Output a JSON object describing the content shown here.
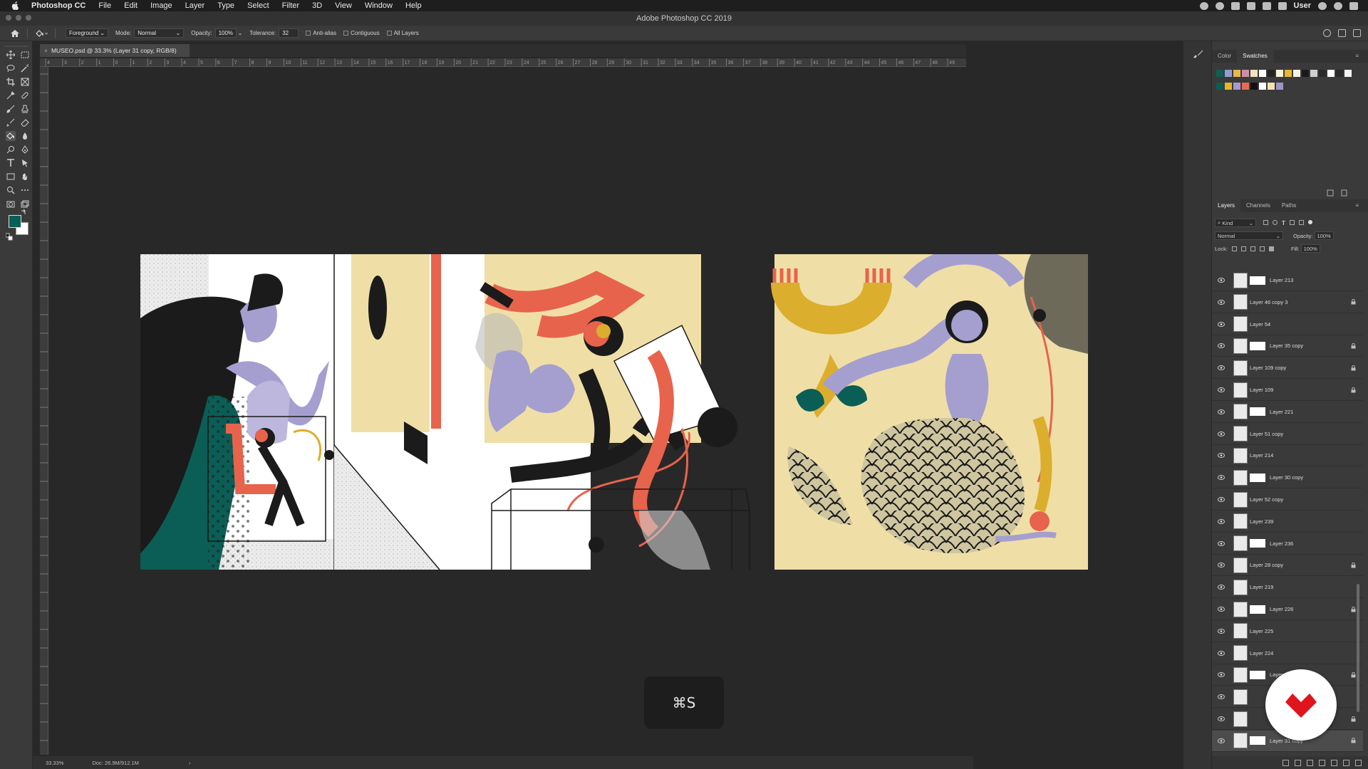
{
  "menubar": {
    "app": "Photoshop CC",
    "items": [
      "File",
      "Edit",
      "Image",
      "Layer",
      "Type",
      "Select",
      "Filter",
      "3D",
      "View",
      "Window",
      "Help"
    ],
    "user": "User"
  },
  "window": {
    "title": "Adobe Photoshop CC 2019"
  },
  "options": {
    "fill_source": "Foreground",
    "mode_label": "Mode:",
    "mode_value": "Normal",
    "opacity_label": "Opacity:",
    "opacity_value": "100%",
    "tolerance_label": "Tolerance:",
    "tolerance_value": "32",
    "anti_alias": "Anti-alias",
    "contiguous": "Contiguous",
    "all_layers": "All Layers"
  },
  "document": {
    "tab": "MUSEO.psd @ 33.3% (Layer 31 copy, RGB/8)",
    "zoom": "33.33%",
    "doc_size": "Doc: 26.9M/912.1M"
  },
  "ruler_top": [
    "4",
    "3",
    "2",
    "1",
    "0",
    "1",
    "2",
    "3",
    "4",
    "5",
    "6",
    "7",
    "8",
    "9",
    "10",
    "11",
    "12",
    "13",
    "14",
    "15",
    "16",
    "17",
    "18",
    "19",
    "20",
    "21",
    "22",
    "23",
    "24",
    "25",
    "26",
    "27",
    "28",
    "29",
    "30",
    "31",
    "32",
    "33",
    "34",
    "35",
    "36",
    "37",
    "38",
    "39",
    "40",
    "41",
    "42",
    "43",
    "44",
    "45",
    "46",
    "47",
    "48",
    "49"
  ],
  "keystroke": "⌘S",
  "color_panel": {
    "tabs": [
      "Color",
      "Swatches"
    ],
    "active_tab": "Swatches",
    "swatch_colors_row1": [
      "#0e5f55",
      "#8f9fd6",
      "#e9b847",
      "#cc8fa8",
      "#f0e4c0",
      "#ffffff",
      "#222222",
      "#f7f1d7",
      "#e8b72f",
      "#f6f2e3",
      "#1a1a1a",
      "#cfcfcf",
      "#2a2a2a",
      "#ffffff",
      "#2b2b2b",
      "#f4f4f4"
    ],
    "swatch_colors_row2": [
      "#0c5c52",
      "#e4b62c",
      "#a69ad0",
      "#e86b55",
      "#121212",
      "#ffffff",
      "#f1e2b2",
      "#9d95c8"
    ]
  },
  "layers_panel": {
    "tabs": [
      "Layers",
      "Channels",
      "Paths"
    ],
    "active_tab": "Layers",
    "kind_label": "Kind",
    "blend_mode": "Normal",
    "opacity_label": "Opacity:",
    "opacity_value": "100%",
    "lock_label": "Lock:",
    "fill_label": "Fill:",
    "fill_value": "100%",
    "layers": [
      {
        "name": "Layer 213",
        "locked": false
      },
      {
        "name": "Layer 46 copy 3",
        "locked": true
      },
      {
        "name": "Layer 54",
        "locked": false
      },
      {
        "name": "Layer 35 copy",
        "locked": true
      },
      {
        "name": "Layer 109 copy",
        "locked": true
      },
      {
        "name": "Layer 109",
        "locked": true
      },
      {
        "name": "Layer 221",
        "locked": false
      },
      {
        "name": "Layer 51 copy",
        "locked": false
      },
      {
        "name": "Layer 214",
        "locked": false
      },
      {
        "name": "Layer 30 copy",
        "locked": false
      },
      {
        "name": "Layer 52 copy",
        "locked": false
      },
      {
        "name": "Layer 239",
        "locked": false
      },
      {
        "name": "Layer 236",
        "locked": false
      },
      {
        "name": "Layer 28 copy",
        "locked": true
      },
      {
        "name": "Layer 219",
        "locked": false
      },
      {
        "name": "Layer 226",
        "locked": true
      },
      {
        "name": "Layer 225",
        "locked": false
      },
      {
        "name": "Layer 224",
        "locked": false
      },
      {
        "name": "Layer 241",
        "locked": true
      },
      {
        "name": "",
        "locked": false
      },
      {
        "name": "",
        "locked": true
      },
      {
        "name": "Layer 31 copy",
        "locked": true,
        "selected": true
      }
    ]
  },
  "colors": {
    "teal": "#0b5e55",
    "coral": "#e8634c",
    "cream": "#efdfa6",
    "lavender": "#a59fd0",
    "ink": "#1b1b1b",
    "mustard": "#dcae2d",
    "logo_red": "#e0141c"
  }
}
